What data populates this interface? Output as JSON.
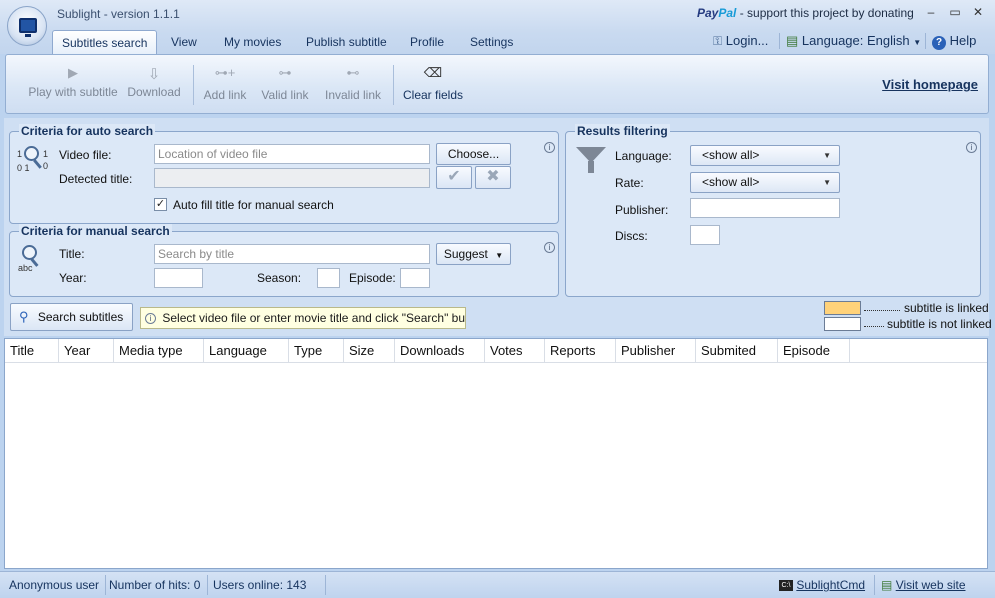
{
  "window": {
    "title": "Sublight - version 1.1.1",
    "paypal_brand": [
      "Pay",
      "Pal"
    ],
    "paypal_text": "- support this project by donating",
    "min_glyph": "–",
    "max_glyph": "▭",
    "close_glyph": "✕"
  },
  "tabs": [
    {
      "label": "Subtitles search",
      "active": true
    },
    {
      "label": "View"
    },
    {
      "label": "My movies"
    },
    {
      "label": "Publish subtitle"
    },
    {
      "label": "Profile"
    },
    {
      "label": "Settings"
    }
  ],
  "topbar": {
    "login": "Login...",
    "language": "Language: English",
    "help": "Help"
  },
  "ribbon": {
    "play_with_subtitle": "Play with subtitle",
    "download": "Download",
    "add_link": "Add link",
    "valid_link": "Valid link",
    "invalid_link": "Invalid link",
    "clear_fields": "Clear fields",
    "visit_homepage": "Visit homepage"
  },
  "auto_search": {
    "title": "Criteria for auto search",
    "video_file_label": "Video file:",
    "video_file_placeholder": "Location of video file",
    "choose_button": "Choose...",
    "detected_title_label": "Detected title:",
    "detected_title_value": "",
    "auto_fill_label": "Auto fill title for manual search",
    "auto_fill_checked": true
  },
  "manual_search": {
    "title": "Criteria for manual search",
    "title_label": "Title:",
    "title_placeholder": "Search by title",
    "suggest_button": "Suggest",
    "year_label": "Year:",
    "season_label": "Season:",
    "episode_label": "Episode:"
  },
  "filtering": {
    "title": "Results filtering",
    "language_label": "Language:",
    "language_value": "<show all>",
    "rate_label": "Rate:",
    "rate_value": "<show all>",
    "publisher_label": "Publisher:",
    "discs_label": "Discs:"
  },
  "search_button": "Search subtitles",
  "hint": "Select video file or enter movie title and click \"Search\" button.",
  "legend": {
    "linked": "subtitle is linked",
    "not_linked": "subtitle is not linked",
    "linked_color": "#ffd27a",
    "not_linked_color": "#ffffff"
  },
  "grid_columns": [
    "Title",
    "Year",
    "Media type",
    "Language",
    "Type",
    "Size",
    "Downloads",
    "Votes",
    "Reports",
    "Publisher",
    "Submited",
    "Episode"
  ],
  "status": {
    "user": "Anonymous user",
    "hits": "Number of hits: 0",
    "online": "Users online: 143",
    "cmd": "SublightCmd",
    "site": "Visit web site"
  }
}
